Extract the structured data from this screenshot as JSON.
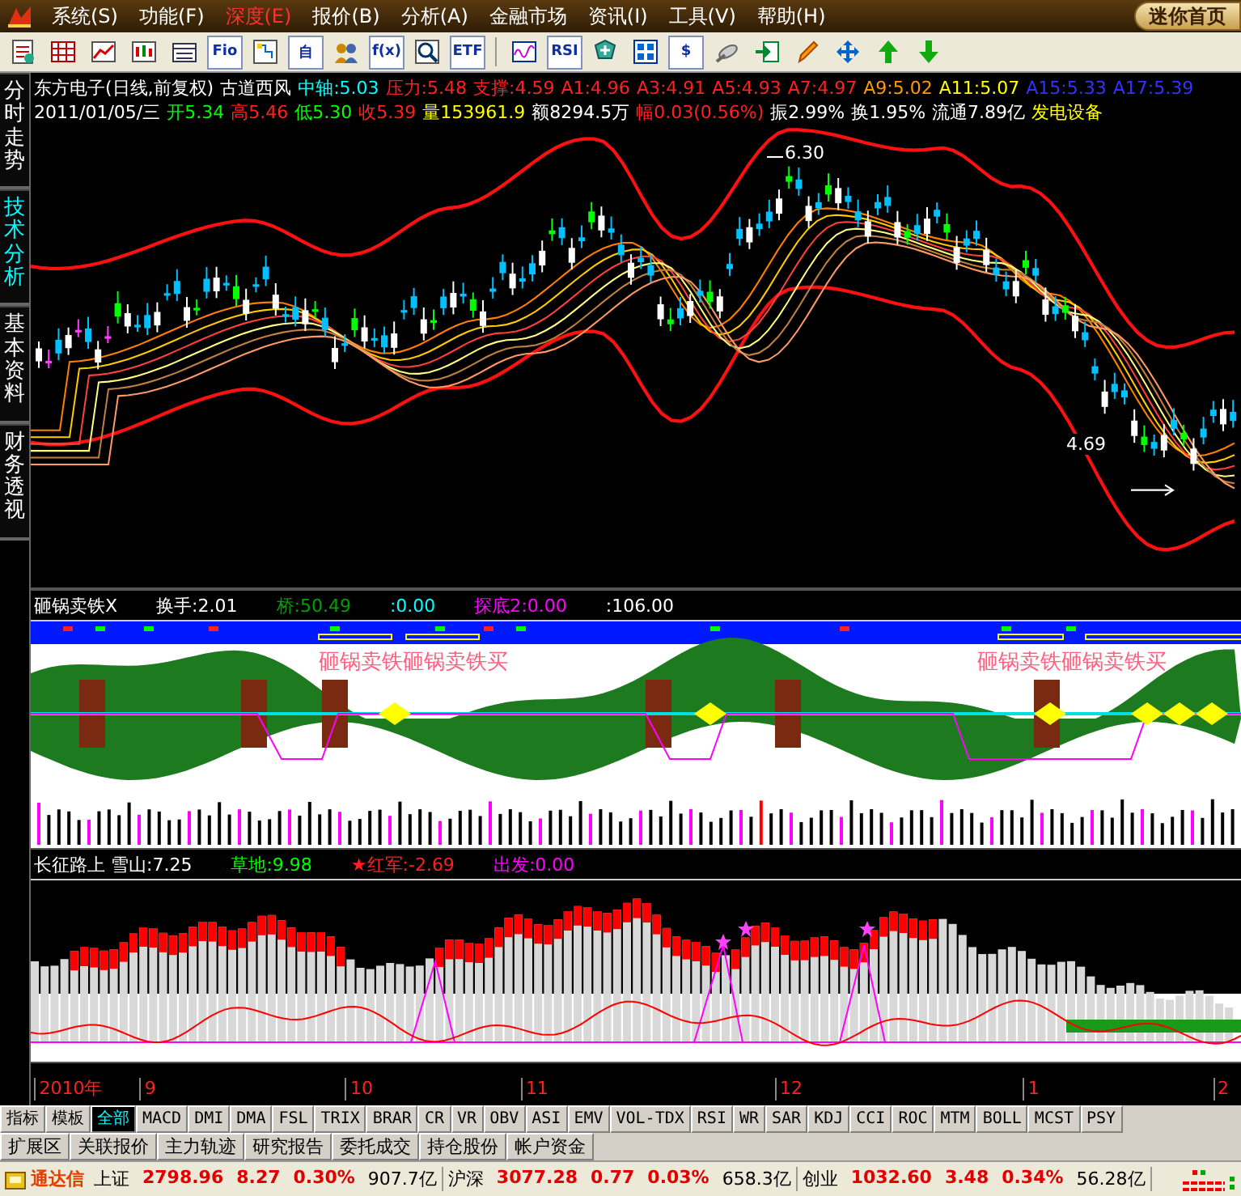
{
  "menu": {
    "items": [
      {
        "label": "系统(S)",
        "selected": false
      },
      {
        "label": "功能(F)",
        "selected": false
      },
      {
        "label": "深度(E)",
        "selected": true
      },
      {
        "label": "报价(B)",
        "selected": false
      },
      {
        "label": "分析(A)",
        "selected": false
      },
      {
        "label": "金融市场",
        "selected": false
      },
      {
        "label": "资讯(I)",
        "selected": false
      },
      {
        "label": "工具(V)",
        "selected": false
      },
      {
        "label": "帮助(H)",
        "selected": false
      }
    ],
    "home_button": "迷你首页"
  },
  "toolbar": [
    {
      "kind": "icon"
    },
    {
      "kind": "icon"
    },
    {
      "kind": "icon"
    },
    {
      "kind": "icon"
    },
    {
      "kind": "icon"
    },
    {
      "kind": "text",
      "label": "Fio"
    },
    {
      "kind": "icon"
    },
    {
      "kind": "text",
      "label": "自"
    },
    {
      "kind": "icon"
    },
    {
      "kind": "text",
      "label": "f(x)"
    },
    {
      "kind": "icon"
    },
    {
      "kind": "text",
      "label": "ETF"
    },
    {
      "kind": "separator"
    },
    {
      "kind": "icon"
    },
    {
      "kind": "text",
      "label": "RSI"
    },
    {
      "kind": "icon"
    },
    {
      "kind": "icon"
    },
    {
      "kind": "text",
      "label": "$"
    },
    {
      "kind": "icon"
    },
    {
      "kind": "icon"
    },
    {
      "kind": "icon"
    },
    {
      "kind": "icon"
    },
    {
      "kind": "icon"
    },
    {
      "kind": "icon"
    }
  ],
  "side_tabs": [
    {
      "label": "分时走势",
      "selected": false
    },
    {
      "label": "技术分析",
      "selected": true
    },
    {
      "label": "基本资料",
      "selected": false
    },
    {
      "label": "财务透视",
      "selected": false
    }
  ],
  "quote": {
    "title": "东方电子(日线,前复权)",
    "formula": "古道西风",
    "levels": [
      {
        "text": "中轴:5.03",
        "color": "#00ffff"
      },
      {
        "text": "压力:5.48",
        "color": "#ff2020"
      },
      {
        "text": "支撑:4.59",
        "color": "#ff2020"
      },
      {
        "text": "A1:4.96",
        "color": "#ff2020"
      },
      {
        "text": "A3:4.91",
        "color": "#ff2020"
      },
      {
        "text": "A5:4.93",
        "color": "#ff2020"
      },
      {
        "text": "A7:4.97",
        "color": "#ff2020"
      },
      {
        "text": "A9:5.02",
        "color": "#ff9900"
      },
      {
        "text": "A11:5.07",
        "color": "#ffff00"
      },
      {
        "text": "A15:5.33",
        "color": "#3333ff"
      },
      {
        "text": "A17:5.39",
        "color": "#3333ff"
      }
    ],
    "day": [
      {
        "text": "2011/01/05/三",
        "color": "#ffffff"
      },
      {
        "text": "开5.34",
        "color": "#00ff00"
      },
      {
        "text": "高5.46",
        "color": "#ff2020"
      },
      {
        "text": "低5.30",
        "color": "#00ff00"
      },
      {
        "text": "收5.39",
        "color": "#ff2020"
      },
      {
        "text": "量153961.9",
        "color": "#ffff00"
      },
      {
        "text": "额8294.5万",
        "color": "#ffffff"
      },
      {
        "text": "幅0.03(0.56%)",
        "color": "#ff2020"
      },
      {
        "text": "振2.99%",
        "color": "#ffffff"
      },
      {
        "text": "换1.95%",
        "color": "#ffffff"
      },
      {
        "text": "流通7.89亿",
        "color": "#ffffff"
      },
      {
        "text": "发电设备",
        "color": "#ffff00"
      }
    ]
  },
  "price_chart": {
    "high_label": "6.30",
    "low_label": "4.69"
  },
  "middle_indicator": {
    "readings": [
      {
        "text": "砸锅卖铁X",
        "color": "#ffffff"
      },
      {
        "text": "换手:2.01",
        "color": "#ffffff"
      },
      {
        "text": "桥:50.49",
        "color": "#00a000"
      },
      {
        "text": ":0.00",
        "color": "#00ffff"
      },
      {
        "text": "探底2:0.00",
        "color": "#ff00ff"
      },
      {
        "text": ":106.00",
        "color": "#ffffff"
      }
    ],
    "signals": [
      "砸锅卖铁砸锅卖铁买",
      "砸锅卖铁砸锅卖铁买"
    ]
  },
  "lower_indicator": {
    "readings": [
      {
        "text": "长征路上 雪山:7.25",
        "color": "#ffffff"
      },
      {
        "text": "草地:9.98",
        "color": "#00ff00"
      },
      {
        "text": "★红军:-2.69",
        "color": "#ff2020"
      },
      {
        "text": "出发:0.00",
        "color": "#ff00ff"
      }
    ]
  },
  "date_axis": [
    "2010年",
    "9",
    "10",
    "11",
    "12",
    "1",
    "2"
  ],
  "indicator_tabs": [
    {
      "label": "指标",
      "selected": false
    },
    {
      "label": "模板",
      "selected": false
    },
    {
      "label": "全部",
      "selected": true
    },
    {
      "label": "MACD",
      "selected": false
    },
    {
      "label": "DMI",
      "selected": false
    },
    {
      "label": "DMA",
      "selected": false
    },
    {
      "label": "FSL",
      "selected": false
    },
    {
      "label": "TRIX",
      "selected": false
    },
    {
      "label": "BRAR",
      "selected": false
    },
    {
      "label": "CR",
      "selected": false
    },
    {
      "label": "VR",
      "selected": false
    },
    {
      "label": "OBV",
      "selected": false
    },
    {
      "label": "ASI",
      "selected": false
    },
    {
      "label": "EMV",
      "selected": false
    },
    {
      "label": "VOL-TDX",
      "selected": false
    },
    {
      "label": "RSI",
      "selected": false
    },
    {
      "label": "WR",
      "selected": false
    },
    {
      "label": "SAR",
      "selected": false
    },
    {
      "label": "KDJ",
      "selected": false
    },
    {
      "label": "CCI",
      "selected": false
    },
    {
      "label": "ROC",
      "selected": false
    },
    {
      "label": "MTM",
      "selected": false
    },
    {
      "label": "BOLL",
      "selected": false
    },
    {
      "label": "MCST",
      "selected": false
    },
    {
      "label": "PSY",
      "selected": false
    }
  ],
  "extension_tabs": [
    {
      "label": "扩展区",
      "selected": false
    },
    {
      "label": "关联报价",
      "selected": false
    },
    {
      "label": "主力轨迹",
      "selected": false
    },
    {
      "label": "研究报告",
      "selected": false
    },
    {
      "label": "委托成交",
      "selected": false
    },
    {
      "label": "持仓股份",
      "selected": false
    },
    {
      "label": "帐户资金",
      "selected": false
    }
  ],
  "status_bar": {
    "brand": "通达信",
    "indices": [
      {
        "name": "上证",
        "value": "2798.96",
        "change": "8.27",
        "percent": "0.30%",
        "amount": "907.7亿"
      },
      {
        "name": "沪深",
        "value": "3077.28",
        "change": "0.77",
        "percent": "0.03%",
        "amount": "658.3亿"
      },
      {
        "name": "创业",
        "value": "1032.60",
        "change": "3.48",
        "percent": "0.34%",
        "amount": "56.28亿"
      }
    ]
  }
}
